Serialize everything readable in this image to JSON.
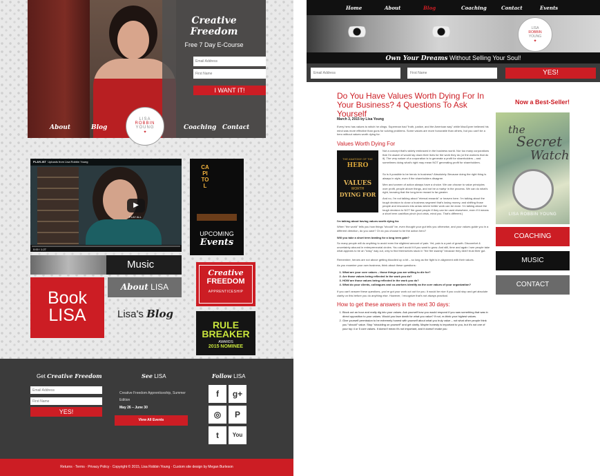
{
  "left": {
    "hero": {
      "title_line1": "Creative",
      "title_line2": "Freedom",
      "subtitle": "Free 7 Day E-Course",
      "email_placeholder": "Email Address",
      "name_placeholder": "First Name",
      "button": "I WANT IT!"
    },
    "nav": [
      "About",
      "Blog",
      "Coaching",
      "Contact"
    ],
    "logo": {
      "line1": "LISA",
      "line2": "ROBBIN",
      "line3": "YOUNG"
    },
    "video": {
      "playlist_label": "PLAYLIST",
      "playlist_title": "Uploads from Lisa Robbin Young",
      "play_all": "PLAY ALL",
      "time": "0:00 / 1:27"
    },
    "capitol": {
      "marquee": "CAPITOL",
      "upcoming": "UPCOMING",
      "events": "Events"
    },
    "music": "Music",
    "about": {
      "bold": "About",
      "rest": "LISA"
    },
    "book": {
      "line1": "Book",
      "line2": "LISA"
    },
    "blog": {
      "plain": "Lisa's",
      "bold": "Blog"
    },
    "cfa": {
      "line1": "Creative",
      "line2": "FREEDOM",
      "line3": "APPRENTICESHIP"
    },
    "rb": {
      "line1": "RULE",
      "line2": "BREAKER",
      "line3": "AWARDS",
      "line4": "2015 NOMINEE"
    },
    "footer": {
      "get_plain": "Get",
      "get_bold": "Creative Freedom",
      "see_bold": "See",
      "see_rest": "LISA",
      "follow_bold": "Follow",
      "follow_rest": "LISA",
      "email_placeholder": "Email Address",
      "name_placeholder": "First Name",
      "yes": "YES!",
      "event_title": "Creative Freedom Apprenticeship, Summer Edition",
      "event_dates": "May 26 – June 30",
      "view_all": "View All Events",
      "social": [
        "f",
        "g+",
        "◎",
        "P",
        "t",
        "You"
      ],
      "bottom": "Returns · Terms · Privacy Policy · Copyright © 2015, Lisa Robbin Young · Custom site design by Megan Burleson"
    }
  },
  "right": {
    "nav": [
      "Home",
      "About",
      "Blog",
      "Coaching",
      "Contact",
      "Events"
    ],
    "active_nav": "Blog",
    "logo": {
      "line1": "LISA",
      "line2": "ROBBIN",
      "line3": "YOUNG"
    },
    "tagline_bold": "Own Your Dreams",
    "tagline_rest": "Without Selling Your Soul!",
    "email_placeholder": "Email Address",
    "name_placeholder": "First Name",
    "yes": "YES!",
    "article": {
      "title": "Do You Have Values Worth Dying For In Your Business? 4 Questions To Ask Yourself",
      "meta": "March 3, 2015 by Lisa Young",
      "intro": "Every hero has values to which he clings. Superman had \"truth, justice, and the American way\" while MacGyver believed his mind was more effective than guns for solving problems. Some values are more honorable than others, but you can't be a hero without values worth dying for.",
      "h_values": "Values Worth Dying For",
      "p1": "Not a concept that's widely embraced in the business world. Nor too many corporations that I'm aware of would lay down their lives for the work they do (or the workers that do it). The very nature of a corporation is to generate a profit for shareholders – and sometimes doing what's right may mean NOT generating profit for shareholders.",
      "p2": "So is it possible to be heroic in business? Absolutely. Because doing the right thing is always in style, even if the shareholders disagree.",
      "p3": "Men and women of action always have a choice. We can choose to value principles over profit, people above things, and not be a martyr in the process. We can do what's right, knowing that the long-term reward is far greater.",
      "p4": "And no, I'm not talking about \"eternal rewards\" or heaven here. I'm talking about the tough decision to close a business segment that's losing money, and shifting those people and resources into areas where better work can be done. I'm talking about the tough decision to NOT fire good people if they can be used elsewhere, even if it means a short term cashflow pinch (not crisis, mind you. That's different.)",
      "bold1": "I'm talking about having values worth dying for.",
      "p5": "When \"the world\" tells you how things \"should\" be, even thought your gut tells you otherwise, and your values guide you in a different direction, do you cave? Or do you choose to be the action hero?",
      "bold2": "Will you take a short term beating for a long term gain?",
      "p6": "So many people will do anything to avoid even the slightest amount of pain. Yet, pain is a part of growth. Discomfort & uncertainty abound in entrepreneurial circles. You can't avoid it if you want to grow. And still, time and again I see people take what appears to be an \"easy\" way out, only to find themselves stuck in \"the fire swamp\" because they didn't trust their gut.",
      "p7": "Remember, heroes are not above getting bloodied up a bit – so long as the fight is in alignment with their values.",
      "p8": "As you examine your own business, think about these questions:",
      "questions": [
        "What are your core values – those things you are willing to die for?",
        "Are those values being reflected in the work you do?",
        "HOW are those values being reflected in the work you do?",
        "What do your clients, colleagues and co-workers identify as the core values of your organization?"
      ],
      "p9": "If you can't answer these questions, you've got your work cut out for you. It would be nice if you could stop and get absolute clarity on this before you do anything else. However, I recognize that's not always practical.",
      "h_answers": "How to get these answers in the next 30 days:",
      "steps": [
        "Block out an hour and really dig into your values. Ask yourself how you would respond if you saw something that was in direct opposition to your values. Would you face death for what you value? If not, re-think your highest values.",
        "Give yourself permission to be extremely honest with yourself about what you truly value – not what other people think you \"should\" value. Stop \"shoulding on yourself\" and get clarity. Maybe honesty is important to you, but it's not one of your top 4 or 5 core values. It doesn't mean it's not important, and it doesn't make you"
      ],
      "book_thumb": {
        "line1": "THE ANATOMY OF THE",
        "line2": "HERO",
        "line3": "VALUES",
        "line4": "WORTH",
        "line5": "DYING FOR"
      }
    },
    "sidebar": {
      "title": "Now a Best-Seller!",
      "book_the": "the",
      "book_secret": "Secret",
      "book_watch": "Watch",
      "book_author": "LISA ROBBIN YOUNG",
      "coaching": "COACHING",
      "music": "MUSIC",
      "contact": "CONTACT"
    }
  },
  "colors": {
    "accent": "#cc1d24",
    "dark": "#3b3b3b",
    "black": "#111111"
  }
}
